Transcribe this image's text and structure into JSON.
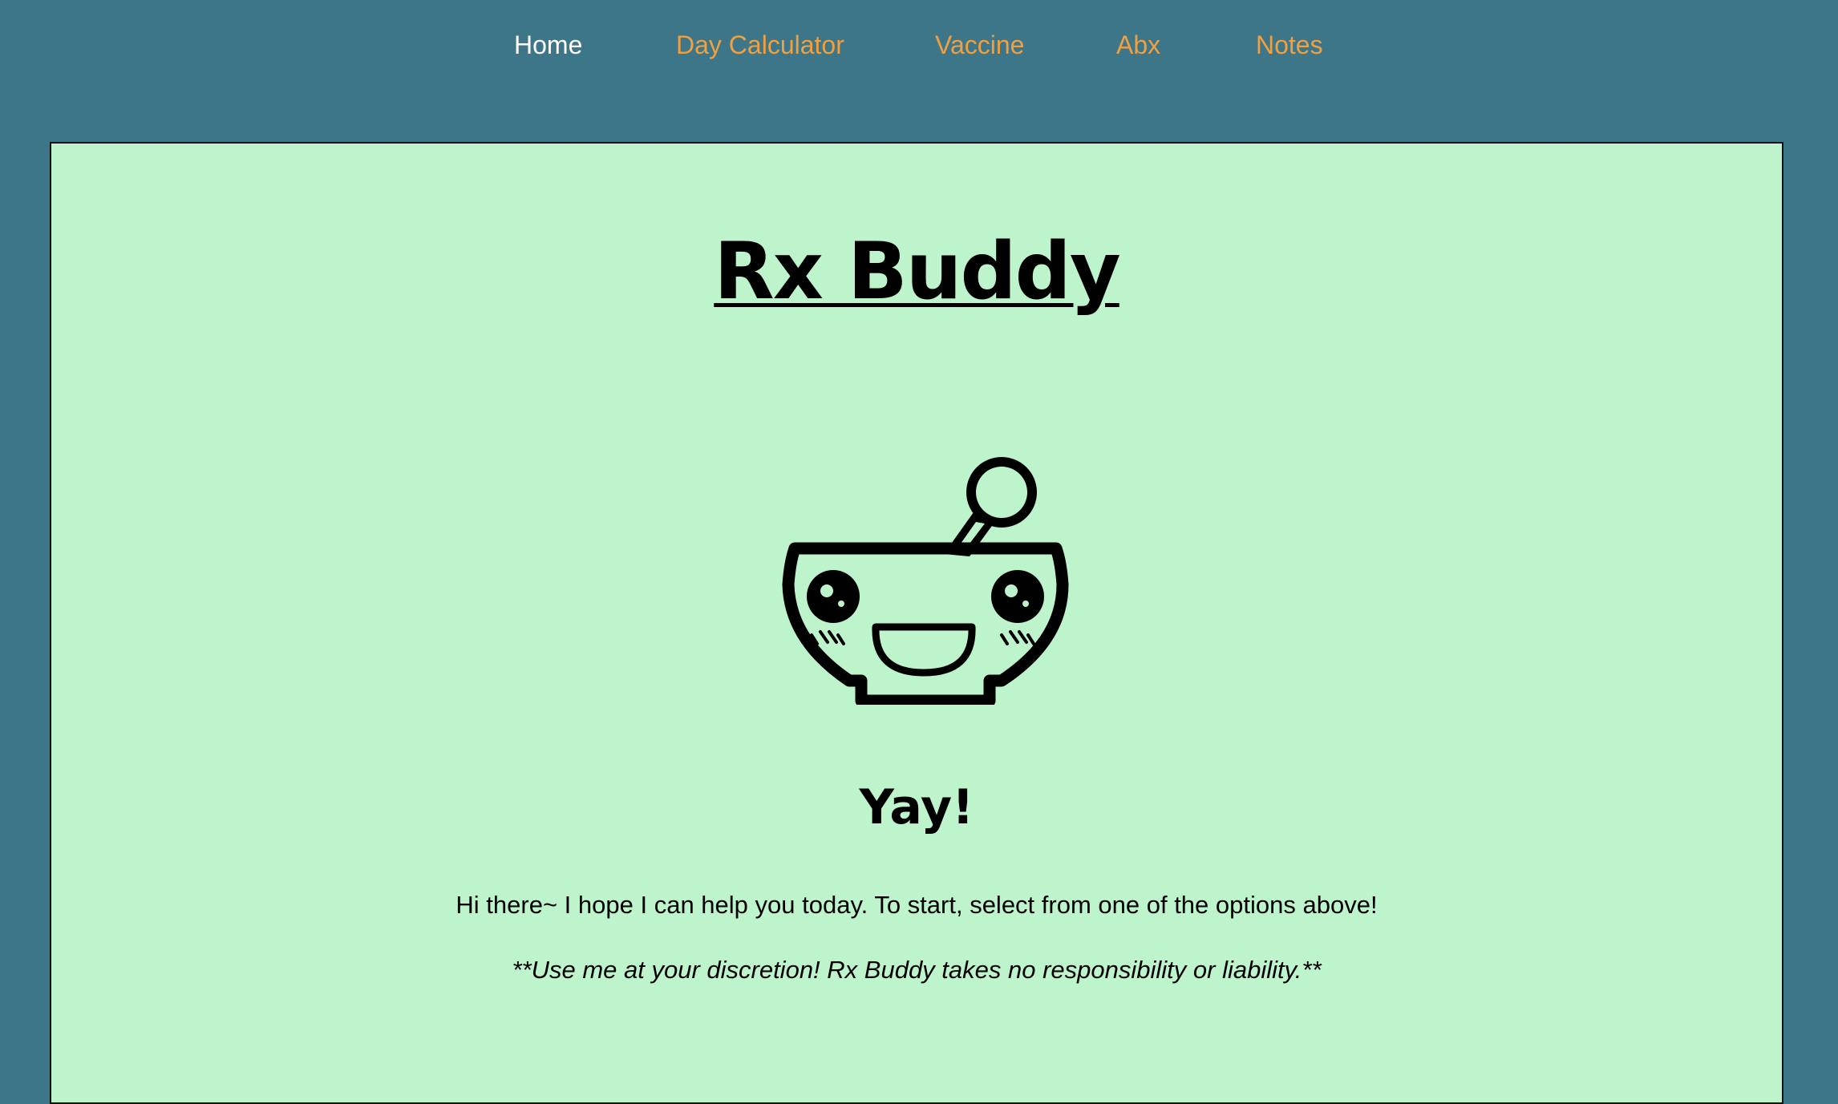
{
  "nav": {
    "items": [
      {
        "label": "Home",
        "active": true
      },
      {
        "label": "Day Calculator",
        "active": false
      },
      {
        "label": "Vaccine",
        "active": false
      },
      {
        "label": "Abx",
        "active": false
      },
      {
        "label": "Notes",
        "active": false
      }
    ],
    "active_color": "#ffffff",
    "link_color": "#f0a040"
  },
  "main": {
    "title": "Rx Buddy",
    "mascot_icon": "happy-mortar-and-pestle-icon",
    "heading": "Yay!",
    "intro": "Hi there~ I hope I can help you today. To start, select from one of the options above!",
    "disclaimer": "**Use me at your discretion! Rx Buddy takes no responsibility or liability.**"
  },
  "colors": {
    "page_background": "#3d7689",
    "card_background": "#bef4cc",
    "text": "#000000"
  }
}
